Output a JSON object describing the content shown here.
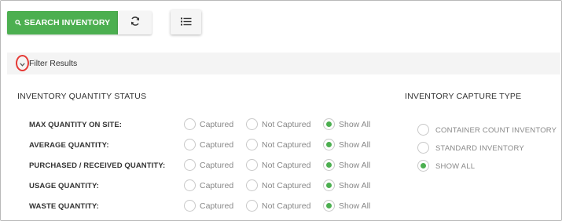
{
  "toolbar": {
    "search_button_label": "SEARCH INVENTORY",
    "search_icon": "magnifier-icon",
    "refresh_icon": "refresh-icon",
    "list_icon": "list-view-icon"
  },
  "filter": {
    "label": "Filter Results",
    "toggle_icon": "chevron-down-icon"
  },
  "quantity_status": {
    "title": "INVENTORY QUANTITY STATUS",
    "options": [
      "Captured",
      "Not Captured",
      "Show All"
    ],
    "rows": [
      {
        "label": "MAX QUANTITY ON SITE:",
        "selected": "Show All"
      },
      {
        "label": "AVERAGE QUANTITY:",
        "selected": "Show All"
      },
      {
        "label": "PURCHASED / RECEIVED QUANTITY:",
        "selected": "Show All"
      },
      {
        "label": "USAGE QUANTITY:",
        "selected": "Show All"
      },
      {
        "label": "WASTE QUANTITY:",
        "selected": "Show All"
      }
    ]
  },
  "capture_type": {
    "title": "INVENTORY CAPTURE TYPE",
    "options": [
      {
        "label": "CONTAINER COUNT INVENTORY",
        "checked": false
      },
      {
        "label": "STANDARD INVENTORY",
        "checked": false
      },
      {
        "label": "SHOW ALL",
        "checked": true
      }
    ]
  },
  "colors": {
    "accent": "#4caf50",
    "highlight": "#e53935"
  }
}
